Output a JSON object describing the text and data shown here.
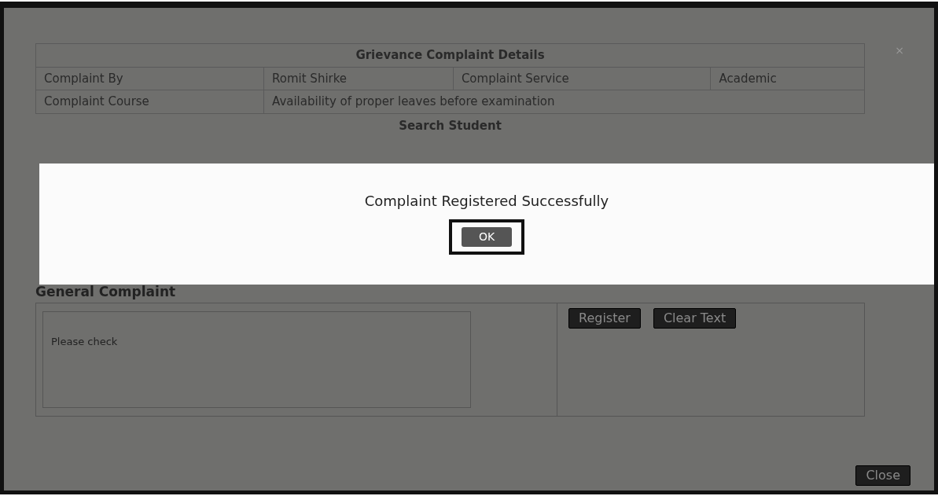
{
  "details": {
    "title": "Grievance Complaint Details",
    "rows": [
      {
        "label": "Complaint By",
        "value": "Romit Shirke",
        "label_2": "Complaint Service",
        "value_2": "Academic"
      },
      {
        "label": "Complaint Course",
        "value": "Availability of proper leaves before examination"
      }
    ]
  },
  "search": {
    "title": "Search Student"
  },
  "general": {
    "title": "General Complaint",
    "text": "Please check",
    "buttons": [
      "Register",
      "Clear Text"
    ]
  },
  "alert": {
    "message": "Complaint Registered Successfully",
    "button": "OK"
  },
  "close_button": "Close",
  "close_mark": "×"
}
